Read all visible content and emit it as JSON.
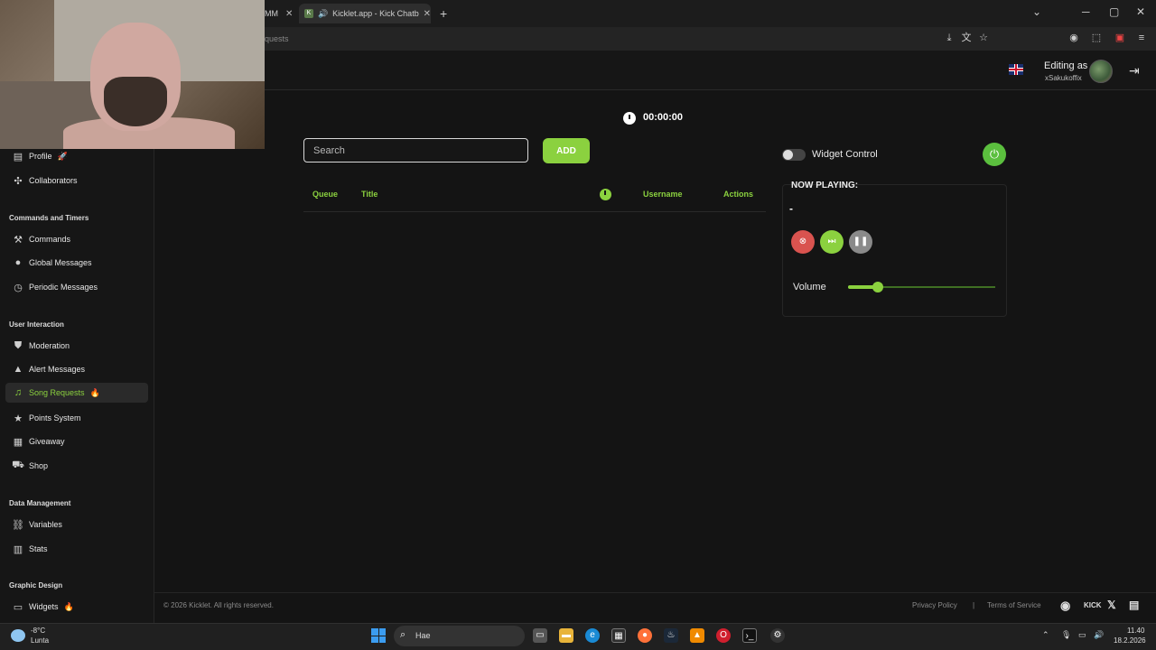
{
  "browser": {
    "tabs": [
      {
        "label": "MM",
        "active": false
      },
      {
        "label": "Kicklet.app - Kick Chatbot",
        "active": true
      }
    ],
    "new_tab": "+",
    "address_fragment": "quests",
    "window_controls": {
      "minimize": "─",
      "maximize": "▢",
      "close": "✕"
    }
  },
  "header": {
    "editing_label": "Editing as",
    "username": "xSakukoffix"
  },
  "sidebar": {
    "top_items": [
      {
        "label": "Profile",
        "icon": "document-icon",
        "badge": "🚀"
      },
      {
        "label": "Collaborators",
        "icon": "users-icon"
      }
    ],
    "sections": [
      {
        "title": "Commands and Timers",
        "items": [
          {
            "label": "Commands",
            "icon": "hammer-icon"
          },
          {
            "label": "Global Messages",
            "icon": "chat-icon"
          },
          {
            "label": "Periodic Messages",
            "icon": "clock-icon"
          }
        ]
      },
      {
        "title": "User Interaction",
        "items": [
          {
            "label": "Moderation",
            "icon": "shield-icon"
          },
          {
            "label": "Alert Messages",
            "icon": "warning-icon"
          },
          {
            "label": "Song Requests",
            "icon": "music-icon",
            "badge": "🔥",
            "active": true
          },
          {
            "label": "Points System",
            "icon": "star-icon"
          },
          {
            "label": "Giveaway",
            "icon": "gift-icon"
          },
          {
            "label": "Shop",
            "icon": "cart-icon"
          }
        ]
      },
      {
        "title": "Data Management",
        "items": [
          {
            "label": "Variables",
            "icon": "link-icon"
          },
          {
            "label": "Stats",
            "icon": "bar-chart-icon"
          }
        ]
      },
      {
        "title": "Graphic Design",
        "items": [
          {
            "label": "Widgets",
            "icon": "monitor-icon",
            "badge": "🔥"
          }
        ]
      }
    ]
  },
  "main": {
    "timer": "00:00:00",
    "search": {
      "placeholder": "Search",
      "value": ""
    },
    "add_label": "ADD",
    "table_headers": {
      "queue": "Queue",
      "title": "Title",
      "username": "Username",
      "actions": "Actions"
    }
  },
  "widget": {
    "control_label": "Widget Control",
    "toggle_on": false,
    "now_playing_label": "NOW PLAYING:",
    "now_playing_track": "-",
    "volume_label": "Volume",
    "volume_level": 0.2,
    "accent_color": "#8bd13f"
  },
  "footer": {
    "copyright": "© 2026 Kicklet. All rights reserved.",
    "privacy": "Privacy Policy",
    "separator": "|",
    "terms": "Terms of Service",
    "social_kick": "KICK"
  },
  "taskbar": {
    "temperature": "-8°C",
    "weather": "Lunta",
    "search_text": "Hae",
    "time": "11.40",
    "date": "18.2.2026"
  }
}
